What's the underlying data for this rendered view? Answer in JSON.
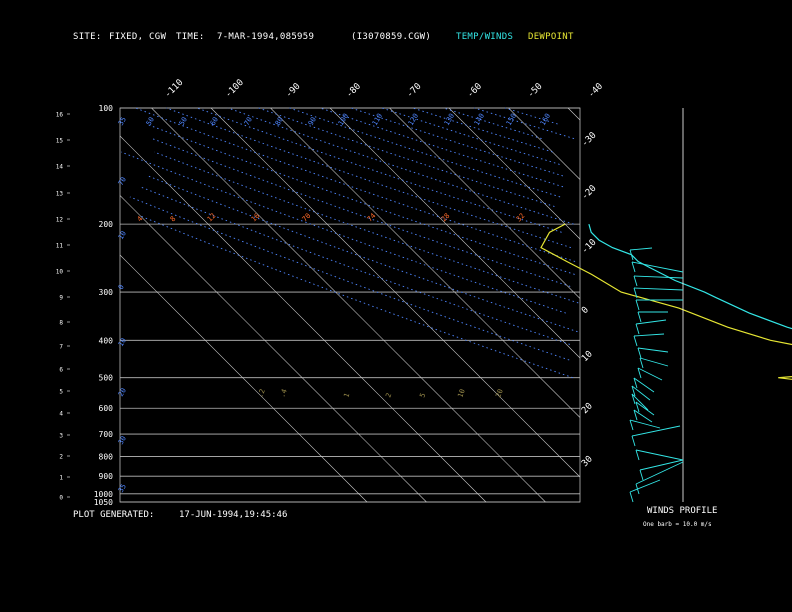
{
  "header": {
    "site_label": "SITE:",
    "site_value": "FIXED, CGW",
    "time_label": "TIME:",
    "time_value": "7-MAR-1994,085959",
    "file": "(I3070859.CGW)",
    "legend_temp": "TEMP/WINDS",
    "legend_dew": "DEWPOINT"
  },
  "footer": {
    "plot_generated_label": "PLOT GENERATED:",
    "plot_generated_value": "17-JUN-1994,19:45:46",
    "winds_profile": "WINDS PROFILE",
    "barb_note": "One barb = 10.0 m/s"
  },
  "colors": {
    "background": "#000000",
    "temp": "#33e6e6",
    "dewpoint": "#e6e633",
    "isobar": "#bbbbbb",
    "isotherm": "#cccccc",
    "dry_adiabat": "#4f86ff",
    "mixing_ratio": "#ff6a2a",
    "moist_adiabat": "#9a8c4a",
    "text": "#ffffff"
  },
  "chart_data": {
    "type": "line",
    "title": "",
    "y_axis": "pressure (hPa), log scale",
    "pressure_range": [
      1050,
      100
    ],
    "pressure_ticks": [
      100,
      200,
      300,
      400,
      500,
      600,
      700,
      800,
      900,
      1000,
      1050
    ],
    "height_ticks_km": [
      0,
      1,
      2,
      3,
      4,
      5,
      6,
      7,
      8,
      9,
      10,
      11,
      12,
      13,
      14,
      15,
      16
    ],
    "isotherm_labels_top": [
      "-110",
      "-100",
      "-90",
      "-80",
      "-70",
      "-60",
      "-50",
      "-40"
    ],
    "isotherm_labels_right": [
      "-30",
      "-20",
      "-10",
      "0",
      "10",
      "20",
      "30"
    ],
    "dry_adiabat_labels": [
      "35",
      "50",
      "50",
      "60",
      "70",
      "80",
      "90",
      "100",
      "110",
      "120",
      "130",
      "140",
      "150",
      "160"
    ],
    "dry_adiabat_labels_left": [
      "70",
      "10",
      "0",
      "10",
      "20",
      "30",
      "35"
    ],
    "mixing_ratio_labels_upper": [
      "4",
      "8",
      "12",
      "16",
      "70",
      "74",
      "28",
      "32"
    ],
    "mixing_ratio_labels_lower": [
      ".2",
      ".4",
      "1",
      "2",
      "5",
      "10",
      "20"
    ],
    "series": [
      {
        "name": "TEMP/WINDS",
        "points": [
          [
            800,
            -1
          ],
          [
            790,
            1
          ],
          [
            780,
            1
          ],
          [
            760,
            -1
          ],
          [
            740,
            -4
          ],
          [
            715,
            -7
          ],
          [
            700,
            -8
          ],
          [
            680,
            -10
          ],
          [
            660,
            -12
          ],
          [
            640,
            -14
          ],
          [
            620,
            -16
          ],
          [
            600,
            -17
          ],
          [
            585,
            -17
          ],
          [
            570,
            -17
          ],
          [
            560,
            -18
          ],
          [
            540,
            -20
          ],
          [
            520,
            -22
          ],
          [
            500,
            -25
          ],
          [
            480,
            -27
          ],
          [
            450,
            -30
          ],
          [
            420,
            -33
          ],
          [
            400,
            -35
          ],
          [
            370,
            -40
          ],
          [
            340,
            -44
          ],
          [
            310,
            -47
          ],
          [
            300,
            -48
          ],
          [
            280,
            -51
          ],
          [
            260,
            -53
          ],
          [
            250,
            -54
          ],
          [
            240,
            -54
          ],
          [
            230,
            -56
          ],
          [
            220,
            -57
          ],
          [
            210,
            -57
          ],
          [
            200,
            -56
          ]
        ]
      },
      {
        "name": "DEWPOINT",
        "points": [
          [
            800,
            -4
          ],
          [
            790,
            -7
          ],
          [
            770,
            -13
          ],
          [
            740,
            -15
          ],
          [
            710,
            -16
          ],
          [
            690,
            -16
          ],
          [
            670,
            -16
          ],
          [
            650,
            -15
          ],
          [
            640,
            -18
          ],
          [
            625,
            -37
          ],
          [
            610,
            -46
          ],
          [
            600,
            -47
          ],
          [
            595,
            -42
          ],
          [
            590,
            -36
          ],
          [
            575,
            -43
          ],
          [
            565,
            -40
          ],
          [
            560,
            -46
          ],
          [
            550,
            -48
          ],
          [
            540,
            -44
          ],
          [
            530,
            -47
          ],
          [
            515,
            -40
          ],
          [
            505,
            -48
          ],
          [
            500,
            -50
          ],
          [
            495,
            -46
          ],
          [
            480,
            -34
          ],
          [
            460,
            -32
          ],
          [
            440,
            -33
          ],
          [
            425,
            -38
          ],
          [
            400,
            -45
          ],
          [
            370,
            -50
          ],
          [
            330,
            -55
          ],
          [
            300,
            -62
          ],
          [
            270,
            -64
          ],
          [
            250,
            -66
          ],
          [
            230,
            -68
          ],
          [
            210,
            -64
          ],
          [
            200,
            -60
          ]
        ]
      }
    ],
    "winds_profile_type": "barbs"
  }
}
